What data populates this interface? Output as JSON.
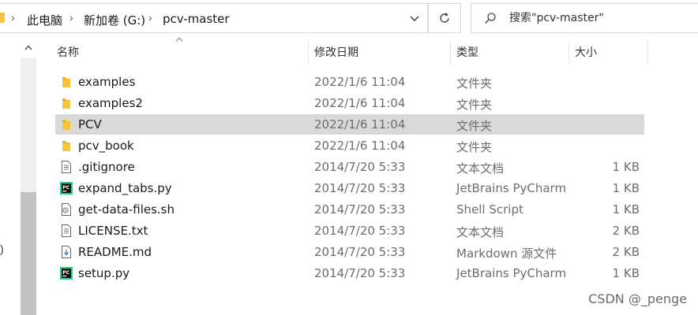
{
  "address_bar": {
    "crumbs": [
      "此电脑",
      "新加卷 (G:)",
      "pcv-master"
    ]
  },
  "search": {
    "placeholder": "搜索\"pcv-master\""
  },
  "columns": {
    "name": "名称",
    "date": "修改日期",
    "type": "类型",
    "size": "大小"
  },
  "nav_fragment": ")",
  "files": [
    {
      "name": "examples",
      "date": "2022/1/6 11:04",
      "type": "文件夹",
      "size": "",
      "icon": "folder-icon"
    },
    {
      "name": "examples2",
      "date": "2022/1/6 11:04",
      "type": "文件夹",
      "size": "",
      "icon": "folder-icon"
    },
    {
      "name": "PCV",
      "date": "2022/1/6 11:04",
      "type": "文件夹",
      "size": "",
      "icon": "folder-icon"
    },
    {
      "name": "pcv_book",
      "date": "2022/1/6 11:04",
      "type": "文件夹",
      "size": "",
      "icon": "folder-icon"
    },
    {
      "name": ".gitignore",
      "date": "2014/7/20 5:33",
      "type": "文本文档",
      "size": "1 KB",
      "icon": "text-file-icon"
    },
    {
      "name": "expand_tabs.py",
      "date": "2014/7/20 5:33",
      "type": "JetBrains PyCharm",
      "size": "1 KB",
      "icon": "pycharm-file-icon"
    },
    {
      "name": "get-data-files.sh",
      "date": "2014/7/20 5:33",
      "type": "Shell Script",
      "size": "1 KB",
      "icon": "shell-script-icon"
    },
    {
      "name": "LICENSE.txt",
      "date": "2014/7/20 5:33",
      "type": "文本文档",
      "size": "2 KB",
      "icon": "text-file-icon"
    },
    {
      "name": "README.md",
      "date": "2014/7/20 5:33",
      "type": "Markdown 源文件",
      "size": "2 KB",
      "icon": "markdown-file-icon"
    },
    {
      "name": "setup.py",
      "date": "2014/7/20 5:33",
      "type": "JetBrains PyCharm",
      "size": "1 KB",
      "icon": "pycharm-file-icon"
    }
  ],
  "selected_row": 2,
  "watermark": "CSDN @_penge",
  "colors": {
    "selected_bg": "#d9d9d9",
    "folder": "#f5c542",
    "scrollbar_thumb": "#c2c2c2"
  }
}
